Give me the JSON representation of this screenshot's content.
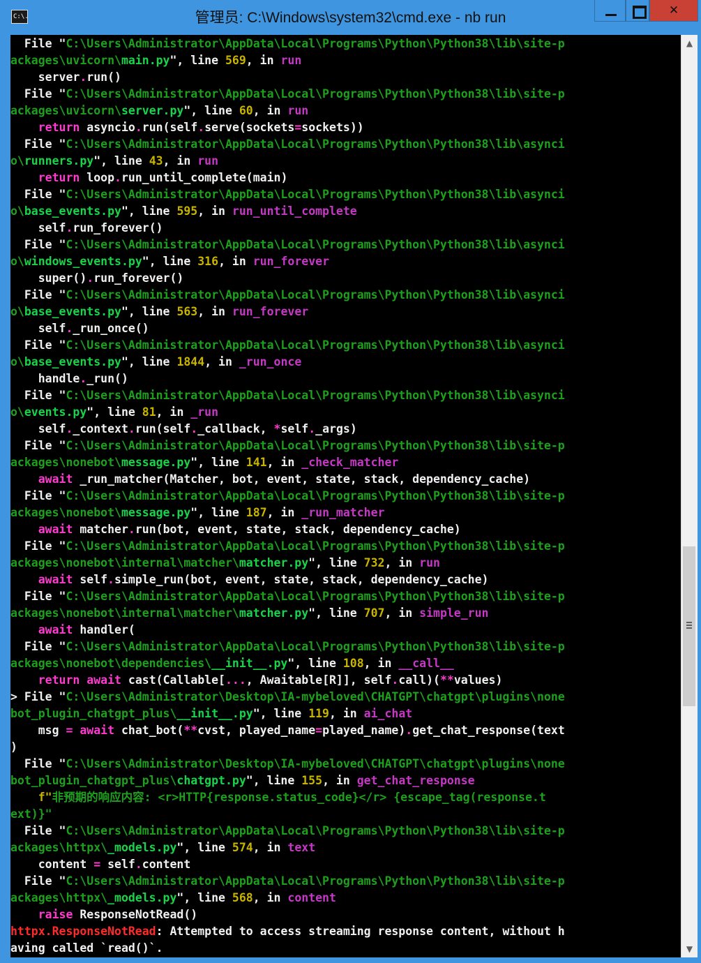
{
  "window": {
    "title": "管理员: C:\\Windows\\system32\\cmd.exe - nb  run",
    "icon_text": "C:\\.",
    "close_glyph": "✕"
  },
  "colors": {
    "frame": "#3f95df",
    "console_bg": "#000000",
    "close_button": "#c94135"
  },
  "scrollbar": {
    "up_arrow": "▲",
    "down_arrow": "▼"
  },
  "console": {
    "lines": [
      [
        [
          "  File \"",
          "w"
        ],
        [
          "C:\\Users\\Administrator\\AppData\\Local\\Programs\\Python\\Python38\\lib\\site-p",
          "g"
        ]
      ],
      [
        [
          "ackages\\uvicorn\\",
          "g"
        ],
        [
          "main.py",
          "c"
        ],
        [
          "\", line ",
          "w"
        ],
        [
          "569",
          "y"
        ],
        [
          ", in ",
          "w"
        ],
        [
          "run",
          "p"
        ]
      ],
      [
        [
          "    server",
          "w"
        ],
        [
          ".",
          "m"
        ],
        [
          "run()",
          "w"
        ]
      ],
      [
        [
          "  File \"",
          "w"
        ],
        [
          "C:\\Users\\Administrator\\AppData\\Local\\Programs\\Python\\Python38\\lib\\site-p",
          "g"
        ]
      ],
      [
        [
          "ackages\\uvicorn\\",
          "g"
        ],
        [
          "server.py",
          "c"
        ],
        [
          "\", line ",
          "w"
        ],
        [
          "60",
          "y"
        ],
        [
          ", in ",
          "w"
        ],
        [
          "run",
          "p"
        ]
      ],
      [
        [
          "    ",
          "w"
        ],
        [
          "return",
          "m"
        ],
        [
          " asyncio",
          "w"
        ],
        [
          ".",
          "m"
        ],
        [
          "run(self",
          "w"
        ],
        [
          ".",
          "m"
        ],
        [
          "serve(sockets",
          "w"
        ],
        [
          "=",
          "m"
        ],
        [
          "sockets))",
          "w"
        ]
      ],
      [
        [
          "  File \"",
          "w"
        ],
        [
          "C:\\Users\\Administrator\\AppData\\Local\\Programs\\Python\\Python38\\lib\\asynci",
          "g"
        ]
      ],
      [
        [
          "o\\",
          "g"
        ],
        [
          "runners.py",
          "c"
        ],
        [
          "\", line ",
          "w"
        ],
        [
          "43",
          "y"
        ],
        [
          ", in ",
          "w"
        ],
        [
          "run",
          "p"
        ]
      ],
      [
        [
          "    ",
          "w"
        ],
        [
          "return",
          "m"
        ],
        [
          " loop",
          "w"
        ],
        [
          ".",
          "m"
        ],
        [
          "run_until_complete(main)",
          "w"
        ]
      ],
      [
        [
          "  File \"",
          "w"
        ],
        [
          "C:\\Users\\Administrator\\AppData\\Local\\Programs\\Python\\Python38\\lib\\asynci",
          "g"
        ]
      ],
      [
        [
          "o\\",
          "g"
        ],
        [
          "base_events.py",
          "c"
        ],
        [
          "\", line ",
          "w"
        ],
        [
          "595",
          "y"
        ],
        [
          ", in ",
          "w"
        ],
        [
          "run_until_complete",
          "p"
        ]
      ],
      [
        [
          "    self",
          "w"
        ],
        [
          ".",
          "m"
        ],
        [
          "run_forever()",
          "w"
        ]
      ],
      [
        [
          "  File \"",
          "w"
        ],
        [
          "C:\\Users\\Administrator\\AppData\\Local\\Programs\\Python\\Python38\\lib\\asynci",
          "g"
        ]
      ],
      [
        [
          "o\\",
          "g"
        ],
        [
          "windows_events.py",
          "c"
        ],
        [
          "\", line ",
          "w"
        ],
        [
          "316",
          "y"
        ],
        [
          ", in ",
          "w"
        ],
        [
          "run_forever",
          "p"
        ]
      ],
      [
        [
          "    super()",
          "w"
        ],
        [
          ".",
          "m"
        ],
        [
          "run_forever()",
          "w"
        ]
      ],
      [
        [
          "  File \"",
          "w"
        ],
        [
          "C:\\Users\\Administrator\\AppData\\Local\\Programs\\Python\\Python38\\lib\\asynci",
          "g"
        ]
      ],
      [
        [
          "o\\",
          "g"
        ],
        [
          "base_events.py",
          "c"
        ],
        [
          "\", line ",
          "w"
        ],
        [
          "563",
          "y"
        ],
        [
          ", in ",
          "w"
        ],
        [
          "run_forever",
          "p"
        ]
      ],
      [
        [
          "    self",
          "w"
        ],
        [
          ".",
          "m"
        ],
        [
          "_run_once()",
          "w"
        ]
      ],
      [
        [
          "  File \"",
          "w"
        ],
        [
          "C:\\Users\\Administrator\\AppData\\Local\\Programs\\Python\\Python38\\lib\\asynci",
          "g"
        ]
      ],
      [
        [
          "o\\",
          "g"
        ],
        [
          "base_events.py",
          "c"
        ],
        [
          "\", line ",
          "w"
        ],
        [
          "1844",
          "y"
        ],
        [
          ", in ",
          "w"
        ],
        [
          "_run_once",
          "p"
        ]
      ],
      [
        [
          "    handle",
          "w"
        ],
        [
          ".",
          "m"
        ],
        [
          "_run()",
          "w"
        ]
      ],
      [
        [
          "  File \"",
          "w"
        ],
        [
          "C:\\Users\\Administrator\\AppData\\Local\\Programs\\Python\\Python38\\lib\\asynci",
          "g"
        ]
      ],
      [
        [
          "o\\",
          "g"
        ],
        [
          "events.py",
          "c"
        ],
        [
          "\", line ",
          "w"
        ],
        [
          "81",
          "y"
        ],
        [
          ", in ",
          "w"
        ],
        [
          "_run",
          "p"
        ]
      ],
      [
        [
          "    self",
          "w"
        ],
        [
          ".",
          "m"
        ],
        [
          "_context",
          "w"
        ],
        [
          ".",
          "m"
        ],
        [
          "run(self",
          "w"
        ],
        [
          ".",
          "m"
        ],
        [
          "_callback, ",
          "w"
        ],
        [
          "*",
          "m"
        ],
        [
          "self",
          "w"
        ],
        [
          ".",
          "m"
        ],
        [
          "_args)",
          "w"
        ]
      ],
      [
        [
          "  File \"",
          "w"
        ],
        [
          "C:\\Users\\Administrator\\AppData\\Local\\Programs\\Python\\Python38\\lib\\site-p",
          "g"
        ]
      ],
      [
        [
          "ackages\\nonebot\\",
          "g"
        ],
        [
          "message.py",
          "c"
        ],
        [
          "\", line ",
          "w"
        ],
        [
          "141",
          "y"
        ],
        [
          ", in ",
          "w"
        ],
        [
          "_check_matcher",
          "p"
        ]
      ],
      [
        [
          "    ",
          "w"
        ],
        [
          "await",
          "m"
        ],
        [
          " _run_matcher(Matcher, bot, event, state, stack, dependency_cache)",
          "w"
        ]
      ],
      [
        [
          "  File \"",
          "w"
        ],
        [
          "C:\\Users\\Administrator\\AppData\\Local\\Programs\\Python\\Python38\\lib\\site-p",
          "g"
        ]
      ],
      [
        [
          "ackages\\nonebot\\",
          "g"
        ],
        [
          "message.py",
          "c"
        ],
        [
          "\", line ",
          "w"
        ],
        [
          "187",
          "y"
        ],
        [
          ", in ",
          "w"
        ],
        [
          "_run_matcher",
          "p"
        ]
      ],
      [
        [
          "    ",
          "w"
        ],
        [
          "await",
          "m"
        ],
        [
          " matcher",
          "w"
        ],
        [
          ".",
          "m"
        ],
        [
          "run(bot, event, state, stack, dependency_cache)",
          "w"
        ]
      ],
      [
        [
          "  File \"",
          "w"
        ],
        [
          "C:\\Users\\Administrator\\AppData\\Local\\Programs\\Python\\Python38\\lib\\site-p",
          "g"
        ]
      ],
      [
        [
          "ackages\\nonebot\\internal\\matcher\\",
          "g"
        ],
        [
          "matcher.py",
          "c"
        ],
        [
          "\", line ",
          "w"
        ],
        [
          "732",
          "y"
        ],
        [
          ", in ",
          "w"
        ],
        [
          "run",
          "p"
        ]
      ],
      [
        [
          "    ",
          "w"
        ],
        [
          "await",
          "m"
        ],
        [
          " self",
          "w"
        ],
        [
          ".",
          "m"
        ],
        [
          "simple_run(bot, event, state, stack, dependency_cache)",
          "w"
        ]
      ],
      [
        [
          "  File \"",
          "w"
        ],
        [
          "C:\\Users\\Administrator\\AppData\\Local\\Programs\\Python\\Python38\\lib\\site-p",
          "g"
        ]
      ],
      [
        [
          "ackages\\nonebot\\internal\\matcher\\",
          "g"
        ],
        [
          "matcher.py",
          "c"
        ],
        [
          "\", line ",
          "w"
        ],
        [
          "707",
          "y"
        ],
        [
          ", in ",
          "w"
        ],
        [
          "simple_run",
          "p"
        ]
      ],
      [
        [
          "    ",
          "w"
        ],
        [
          "await",
          "m"
        ],
        [
          " handler(",
          "w"
        ]
      ],
      [
        [
          "  File \"",
          "w"
        ],
        [
          "C:\\Users\\Administrator\\AppData\\Local\\Programs\\Python\\Python38\\lib\\site-p",
          "g"
        ]
      ],
      [
        [
          "ackages\\nonebot\\dependencies\\",
          "g"
        ],
        [
          "__init__.py",
          "c"
        ],
        [
          "\", line ",
          "w"
        ],
        [
          "108",
          "y"
        ],
        [
          ", in ",
          "w"
        ],
        [
          "__call__",
          "p"
        ]
      ],
      [
        [
          "    ",
          "w"
        ],
        [
          "return",
          "m"
        ],
        [
          " ",
          "w"
        ],
        [
          "await",
          "m"
        ],
        [
          " cast(Callable[",
          "w"
        ],
        [
          "...",
          "m"
        ],
        [
          ", Awaitable[R]], self",
          "w"
        ],
        [
          ".",
          "m"
        ],
        [
          "call)(",
          "w"
        ],
        [
          "**",
          "m"
        ],
        [
          "values)",
          "w"
        ]
      ],
      [
        [
          "> File \"",
          "w"
        ],
        [
          "C:\\Users\\Administrator\\Desktop\\IA-mybeloved\\CHATGPT\\chatgpt\\plugins\\none",
          "g"
        ]
      ],
      [
        [
          "bot_plugin_chatgpt_plus\\",
          "g"
        ],
        [
          "__init__.py",
          "c"
        ],
        [
          "\", line ",
          "w"
        ],
        [
          "119",
          "y"
        ],
        [
          ", in ",
          "w"
        ],
        [
          "ai_chat",
          "p"
        ]
      ],
      [
        [
          "    msg ",
          "w"
        ],
        [
          "=",
          "m"
        ],
        [
          " ",
          "w"
        ],
        [
          "await",
          "m"
        ],
        [
          " chat_bot(",
          "w"
        ],
        [
          "**",
          "m"
        ],
        [
          "cvst, played_name",
          "w"
        ],
        [
          "=",
          "m"
        ],
        [
          "played_name)",
          "w"
        ],
        [
          ".",
          "m"
        ],
        [
          "get_chat_response(text",
          "w"
        ]
      ],
      [
        [
          ")",
          "w"
        ]
      ],
      [
        [
          "  File \"",
          "w"
        ],
        [
          "C:\\Users\\Administrator\\Desktop\\IA-mybeloved\\CHATGPT\\chatgpt\\plugins\\none",
          "g"
        ]
      ],
      [
        [
          "bot_plugin_chatgpt_plus\\",
          "g"
        ],
        [
          "chatgpt.py",
          "c"
        ],
        [
          "\", line ",
          "w"
        ],
        [
          "155",
          "y"
        ],
        [
          ", in ",
          "w"
        ],
        [
          "get_chat_response",
          "p"
        ]
      ],
      [
        [
          "    f\"",
          "y"
        ],
        [
          "非预期的响应内容: <r>HTTP{response.status_code}</r> {escape_tag(response.t",
          "g"
        ]
      ],
      [
        [
          "ext)}\"",
          "g"
        ]
      ],
      [
        [
          "  File \"",
          "w"
        ],
        [
          "C:\\Users\\Administrator\\AppData\\Local\\Programs\\Python\\Python38\\lib\\site-p",
          "g"
        ]
      ],
      [
        [
          "ackages\\httpx\\",
          "g"
        ],
        [
          "_models.py",
          "c"
        ],
        [
          "\", line ",
          "w"
        ],
        [
          "574",
          "y"
        ],
        [
          ", in ",
          "w"
        ],
        [
          "text",
          "p"
        ]
      ],
      [
        [
          "    content ",
          "w"
        ],
        [
          "=",
          "m"
        ],
        [
          " self",
          "w"
        ],
        [
          ".",
          "m"
        ],
        [
          "content",
          "w"
        ]
      ],
      [
        [
          "  File \"",
          "w"
        ],
        [
          "C:\\Users\\Administrator\\AppData\\Local\\Programs\\Python\\Python38\\lib\\site-p",
          "g"
        ]
      ],
      [
        [
          "ackages\\httpx\\",
          "g"
        ],
        [
          "_models.py",
          "c"
        ],
        [
          "\", line ",
          "w"
        ],
        [
          "568",
          "y"
        ],
        [
          ", in ",
          "w"
        ],
        [
          "content",
          "p"
        ]
      ],
      [
        [
          "    ",
          "w"
        ],
        [
          "raise",
          "m"
        ],
        [
          " ResponseNotRead()",
          "w"
        ]
      ],
      [
        [
          "httpx.ResponseNotRead",
          "r"
        ],
        [
          ": Attempted to access streaming response content, without h",
          "w"
        ]
      ],
      [
        [
          "aving called `read()`.",
          "w"
        ]
      ]
    ]
  }
}
